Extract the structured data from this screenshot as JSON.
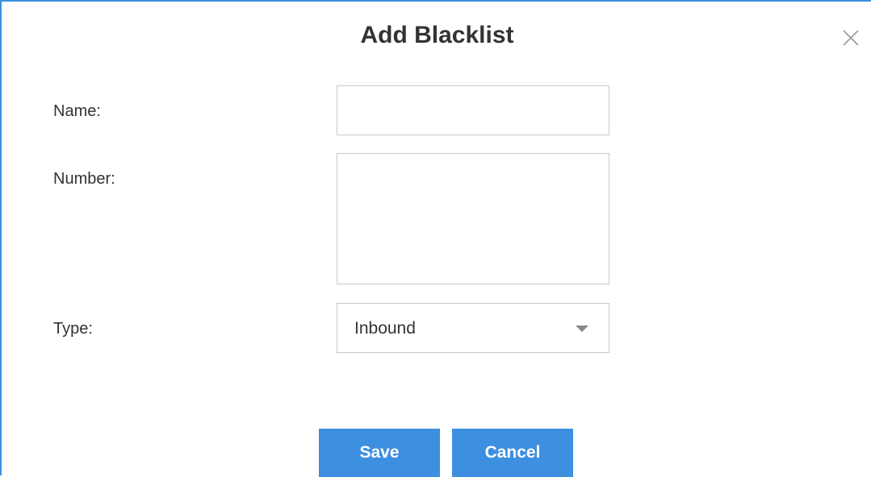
{
  "dialog": {
    "title": "Add Blacklist",
    "close_icon": "close-icon"
  },
  "form": {
    "name": {
      "label": "Name:",
      "value": ""
    },
    "number": {
      "label": "Number:",
      "value": ""
    },
    "type": {
      "label": "Type:",
      "selected": "Inbound",
      "caret_icon": "caret-down-icon"
    }
  },
  "buttons": {
    "save": "Save",
    "cancel": "Cancel"
  },
  "colors": {
    "accent": "#3d8fe0",
    "text": "#333333",
    "border": "#c8c8c8"
  }
}
